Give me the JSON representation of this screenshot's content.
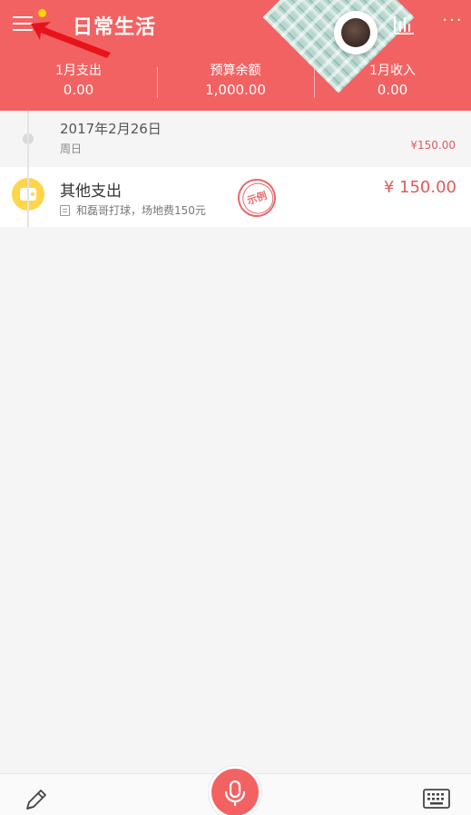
{
  "header": {
    "title": "日常生活",
    "more_label": "···",
    "icons": [
      "menu-icon",
      "bar-chart-icon",
      "more-icon",
      "coffee-avatar"
    ],
    "colors": {
      "header_bg": "#f36262",
      "accent": "#e15a5a",
      "badge": "#ffd400"
    }
  },
  "stats": [
    {
      "label": "1月支出",
      "value": "0.00"
    },
    {
      "label": "预算余额",
      "value": "1,000.00"
    },
    {
      "label": "1月收入",
      "value": "0.00"
    }
  ],
  "day": {
    "date": "2017年2月26日",
    "weekday": "周日",
    "total": "¥150.00"
  },
  "entry": {
    "category": "其他支出",
    "note": "和磊哥打球，场地费150元",
    "stamp": "示例",
    "amount": "¥ 150.00",
    "icon": "wallet-icon"
  },
  "bottom": {
    "icons": [
      "pencil-icon",
      "microphone-icon",
      "keyboard-icon"
    ]
  }
}
